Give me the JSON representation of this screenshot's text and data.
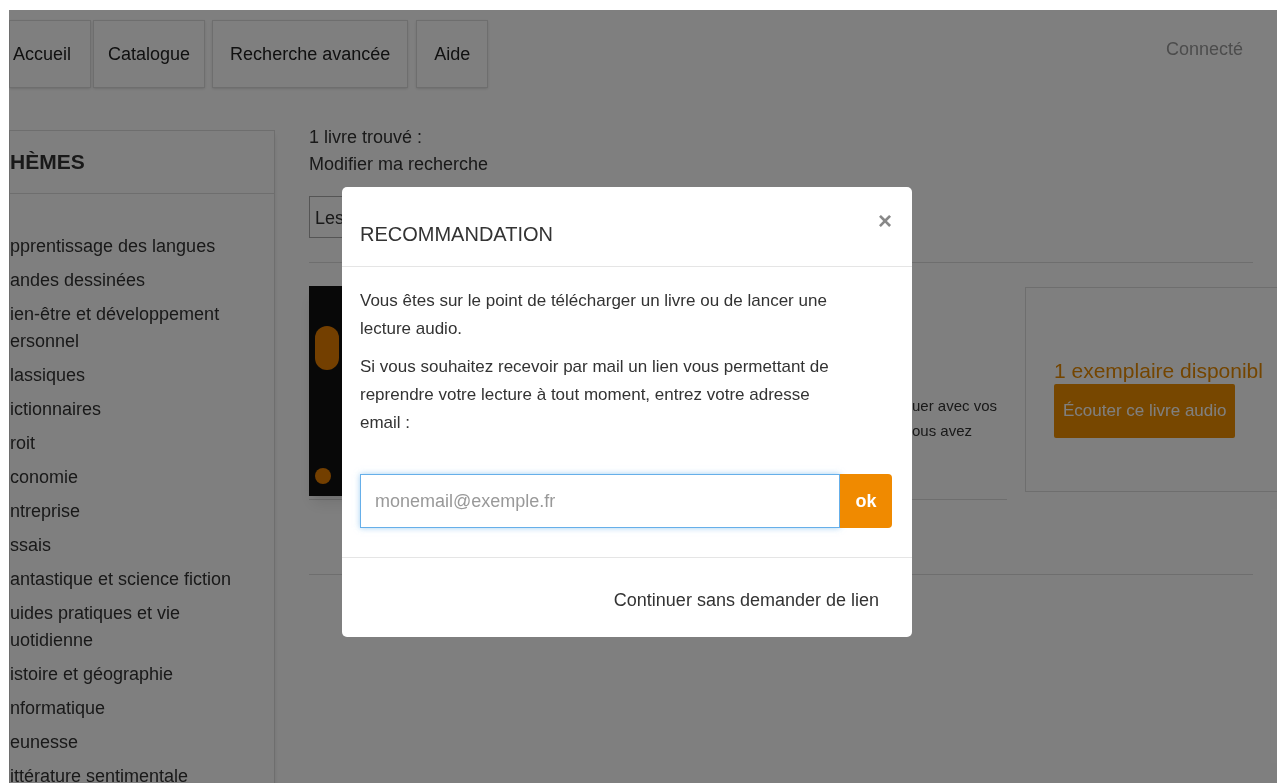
{
  "nav": {
    "items": [
      {
        "label": "Accueil"
      },
      {
        "label": "Catalogue"
      },
      {
        "label": "Recherche avancée"
      },
      {
        "label": "Aide"
      }
    ],
    "user_status": "Connecté"
  },
  "sidebar": {
    "title": "HÈMES",
    "items": [
      "pprentissage des langues",
      "andes dessinées",
      "ien-être et développement ersonnel",
      "lassiques",
      "ictionnaires",
      "roit",
      "conomie",
      "ntreprise",
      "ssais",
      "antastique et science fiction",
      "uides pratiques et vie uotidienne",
      "istoire et géographie",
      "nformatique",
      "eunesse",
      "ittérature sentimentale"
    ]
  },
  "results": {
    "count": "1 livre trouvé :",
    "modify_link": "Modifier ma recherche",
    "sort_select": {
      "value": "Les"
    },
    "book": {
      "description": "uer avec vos ous avez"
    },
    "availability": {
      "text": "1 exemplaire disponibl",
      "button": "Écouter ce livre audio"
    }
  },
  "modal": {
    "title": "RECOMMANDATION",
    "close": "×",
    "paragraphs": [
      "Vous êtes sur le point de télécharger un livre ou de lancer une lecture audio.",
      "Si vous souhaitez recevoir par mail un lien vous permettant de reprendre votre lecture à tout moment, entrez votre adresse email :"
    ],
    "email": {
      "placeholder": "monemail@exemple.fr"
    },
    "submit": "ok",
    "footer_link": "Continuer sans demander de lien"
  }
}
